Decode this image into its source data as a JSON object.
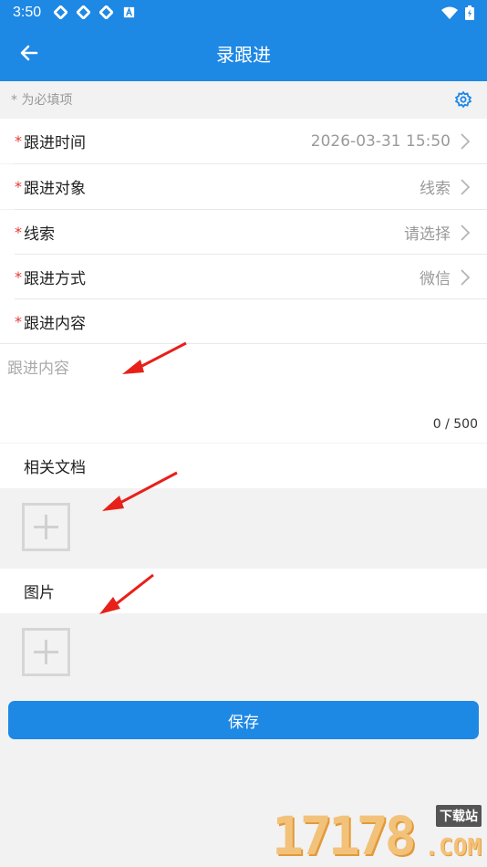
{
  "status_bar": {
    "time": "3:50",
    "icons": [
      "sync-icon",
      "sync-icon",
      "sync-icon",
      "a-box-icon"
    ],
    "right_icons": [
      "wifi-icon",
      "battery-charging-icon"
    ]
  },
  "app_bar": {
    "back_icon": "arrow-left-icon",
    "title": "录跟进",
    "color": "#1e88e5"
  },
  "hint": {
    "text": "* 为必填项",
    "settings_icon": "gear-icon"
  },
  "fields": [
    {
      "required": "*",
      "label": "跟进时间",
      "value": "2026-03-31 15:50"
    },
    {
      "required": "*",
      "label": "跟进对象",
      "value": "线索"
    },
    {
      "required": "*",
      "label": "线索",
      "value": "请选择"
    },
    {
      "required": "*",
      "label": "跟进方式",
      "value": "微信"
    },
    {
      "required": "*",
      "label": "跟进内容",
      "value": ""
    }
  ],
  "content": {
    "placeholder": "跟进内容",
    "value": "",
    "counter": "0 / 500"
  },
  "documents": {
    "title": "相关文档",
    "add_icon": "plus-icon"
  },
  "images": {
    "title": "图片",
    "add_icon": "plus-icon"
  },
  "save_button": {
    "label": "保存"
  },
  "watermark": {
    "number": "17178",
    "tag": "下载站",
    "domain": ".COM"
  }
}
